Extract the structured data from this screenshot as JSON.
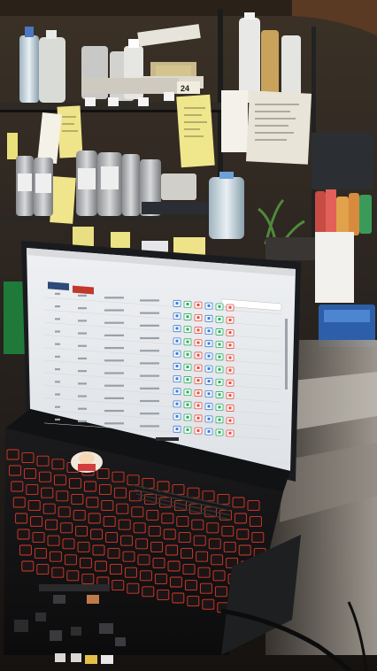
{
  "photo": {
    "subject": "laptop-on-lab-counter",
    "shelf_label": "24",
    "screen": {
      "background": "#e9eaec",
      "header_buttons": [
        {
          "color": "#2c4a7a"
        },
        {
          "color": "#c0392b"
        }
      ],
      "row_count": 11,
      "action_icon_colors": [
        "#3a7bd5",
        "#27ae60",
        "#e74c3c"
      ]
    }
  }
}
